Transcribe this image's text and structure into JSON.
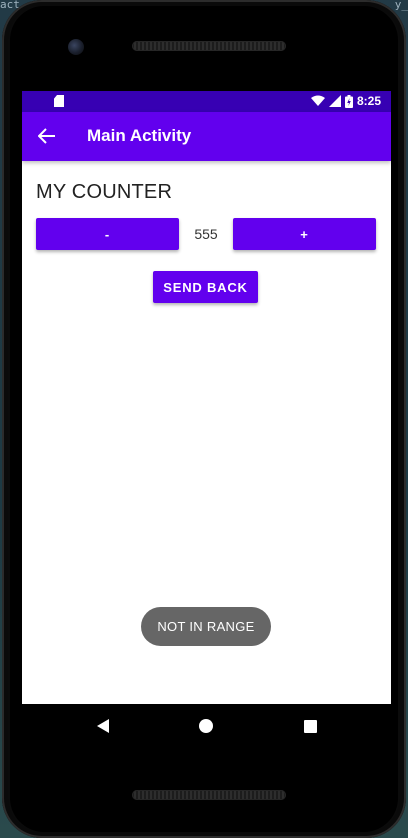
{
  "background": {
    "text_left": "act",
    "text_right": "y_"
  },
  "status_bar": {
    "time": "8:25",
    "icons": [
      "sd-card-icon",
      "wifi-icon",
      "signal-icon",
      "battery-icon"
    ]
  },
  "app_bar": {
    "title": "Main Activity",
    "back_icon": "arrow-back-icon"
  },
  "content": {
    "title": "MY COUNTER",
    "minus_label": "-",
    "plus_label": "+",
    "counter_value": "555",
    "send_back_label": "SEND BACK"
  },
  "toast": {
    "message": "NOT IN RANGE"
  },
  "nav_bar": {
    "icons": [
      "back-triangle-icon",
      "home-circle-icon",
      "recents-square-icon"
    ]
  },
  "colors": {
    "primary": "#6200ee",
    "primary_dark": "#3700b3",
    "toast": "#666666"
  }
}
